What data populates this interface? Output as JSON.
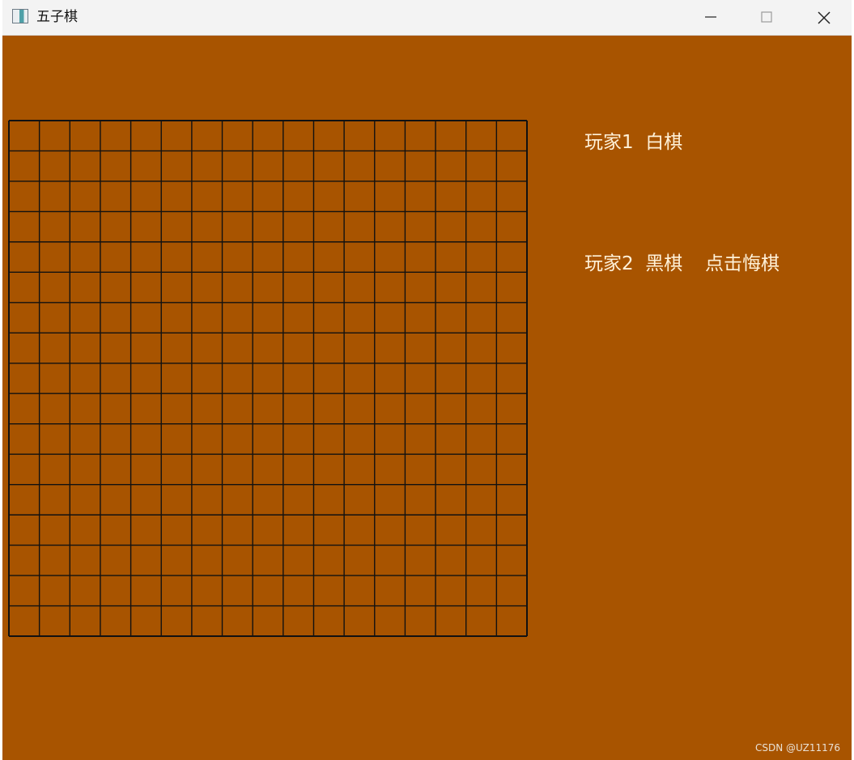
{
  "window": {
    "title": "五子棋",
    "app_icon": "window-app-icon",
    "controls": [
      "minimize-icon",
      "maximize-icon",
      "close-icon"
    ]
  },
  "board": {
    "rows": 17,
    "cols": 17,
    "background": "#a85400",
    "line_color": "#111111"
  },
  "players": {
    "player1": "玩家1  白棋",
    "player2": "玩家2  黑棋"
  },
  "undo_label": "点击悔棋",
  "watermark": "CSDN @UZ11176",
  "colors": {
    "window_bg": "#a85400",
    "text": "#fff1d8",
    "titlebar": "#f3f3f3"
  }
}
